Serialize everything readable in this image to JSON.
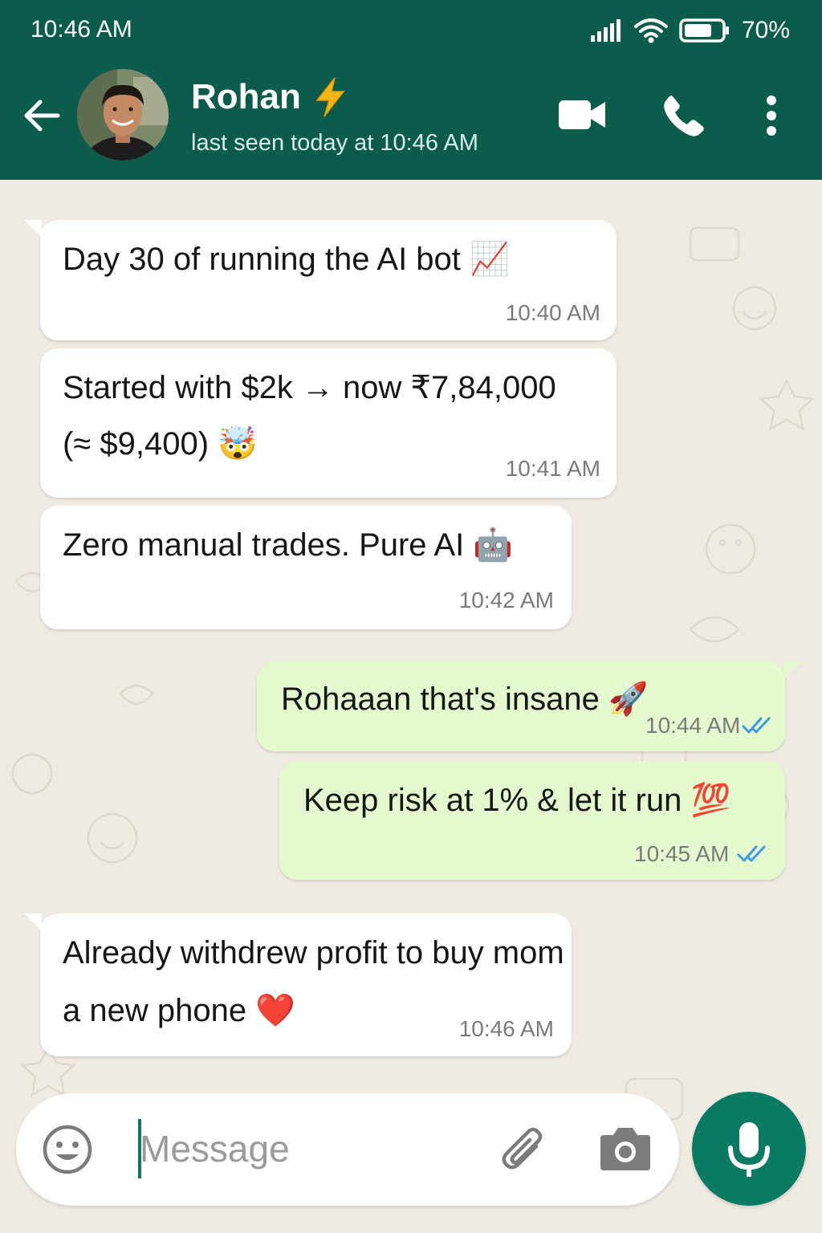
{
  "status_bar": {
    "time": "10:46 AM",
    "battery": "70%"
  },
  "header": {
    "name": "Rohan",
    "name_emoji": "⚡",
    "status": "last seen today at 10:46 AM"
  },
  "messages": [
    {
      "direction": "in",
      "text_lines": [
        "Day 30 of running the AI bot 📈"
      ],
      "time": "10:40 AM"
    },
    {
      "direction": "in",
      "text_lines": [
        "Started with $2k → now ₹7,84,000",
        "(≈ $9,400) 🤯"
      ],
      "time": "10:41 AM"
    },
    {
      "direction": "in",
      "text_lines": [
        "Zero manual trades. Pure AI 🤖"
      ],
      "time": "10:42 AM"
    },
    {
      "direction": "out",
      "text_lines": [
        "Rohaaan that's insane 🚀"
      ],
      "time": "10:44 AM",
      "read": true
    },
    {
      "direction": "out",
      "text_lines": [
        "Keep risk at 1% & let it run 💯"
      ],
      "time": "10:45 AM",
      "read": true
    },
    {
      "direction": "in",
      "text_lines": [
        "Already withdrew profit to buy mom",
        "a new phone ❤️"
      ],
      "time": "10:46 AM"
    }
  ],
  "composer": {
    "placeholder": "Message"
  },
  "colors": {
    "header": "#0b5c4c",
    "accent": "#0b7a63",
    "outgoing": "#e5f9cf",
    "incoming": "#ffffff",
    "read_ticks": "#3a9be0",
    "background": "#efeae2"
  }
}
